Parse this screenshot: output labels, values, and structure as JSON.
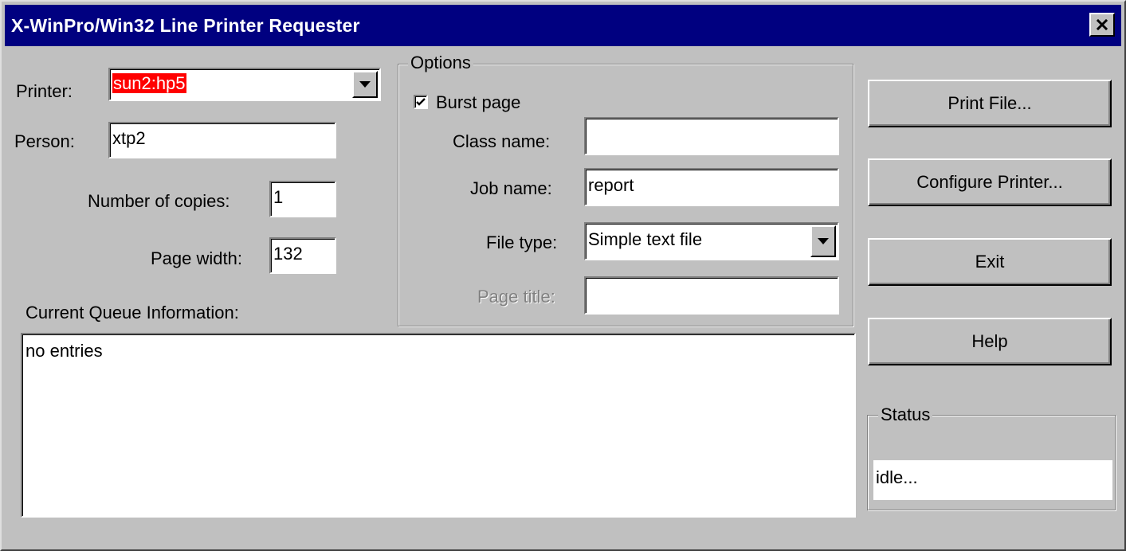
{
  "window": {
    "title": "X-WinPro/Win32 Line Printer Requester",
    "close_glyph": "✕"
  },
  "form": {
    "printer_label": "Printer:",
    "printer_value": "sun2:hp5",
    "person_label": "Person:",
    "person_value": "xtp2",
    "copies_label": "Number of copies:",
    "copies_value": "1",
    "page_width_label": "Page width:",
    "page_width_value": "132"
  },
  "options": {
    "group_label": "Options",
    "burst_page_label": "Burst page",
    "burst_page_checked": true,
    "class_name_label": "Class name:",
    "class_name_value": "",
    "job_name_label": "Job name:",
    "job_name_value": "report",
    "file_type_label": "File type:",
    "file_type_value": "Simple text file",
    "page_title_label": "Page title:",
    "page_title_value": ""
  },
  "queue": {
    "label": "Current Queue Information:",
    "content": "no entries"
  },
  "buttons": {
    "print_file": "Print File...",
    "configure_printer": "Configure Printer...",
    "exit": "Exit",
    "help": "Help"
  },
  "status": {
    "group_label": "Status",
    "value": "idle..."
  },
  "colors": {
    "title_bar": "#000080",
    "dialog_face": "#c0c0c0",
    "selection_highlight": "#ff0000"
  },
  "icons": {
    "close": "close-icon",
    "dropdown": "chevron-down-icon",
    "check": "checkmark-icon"
  }
}
